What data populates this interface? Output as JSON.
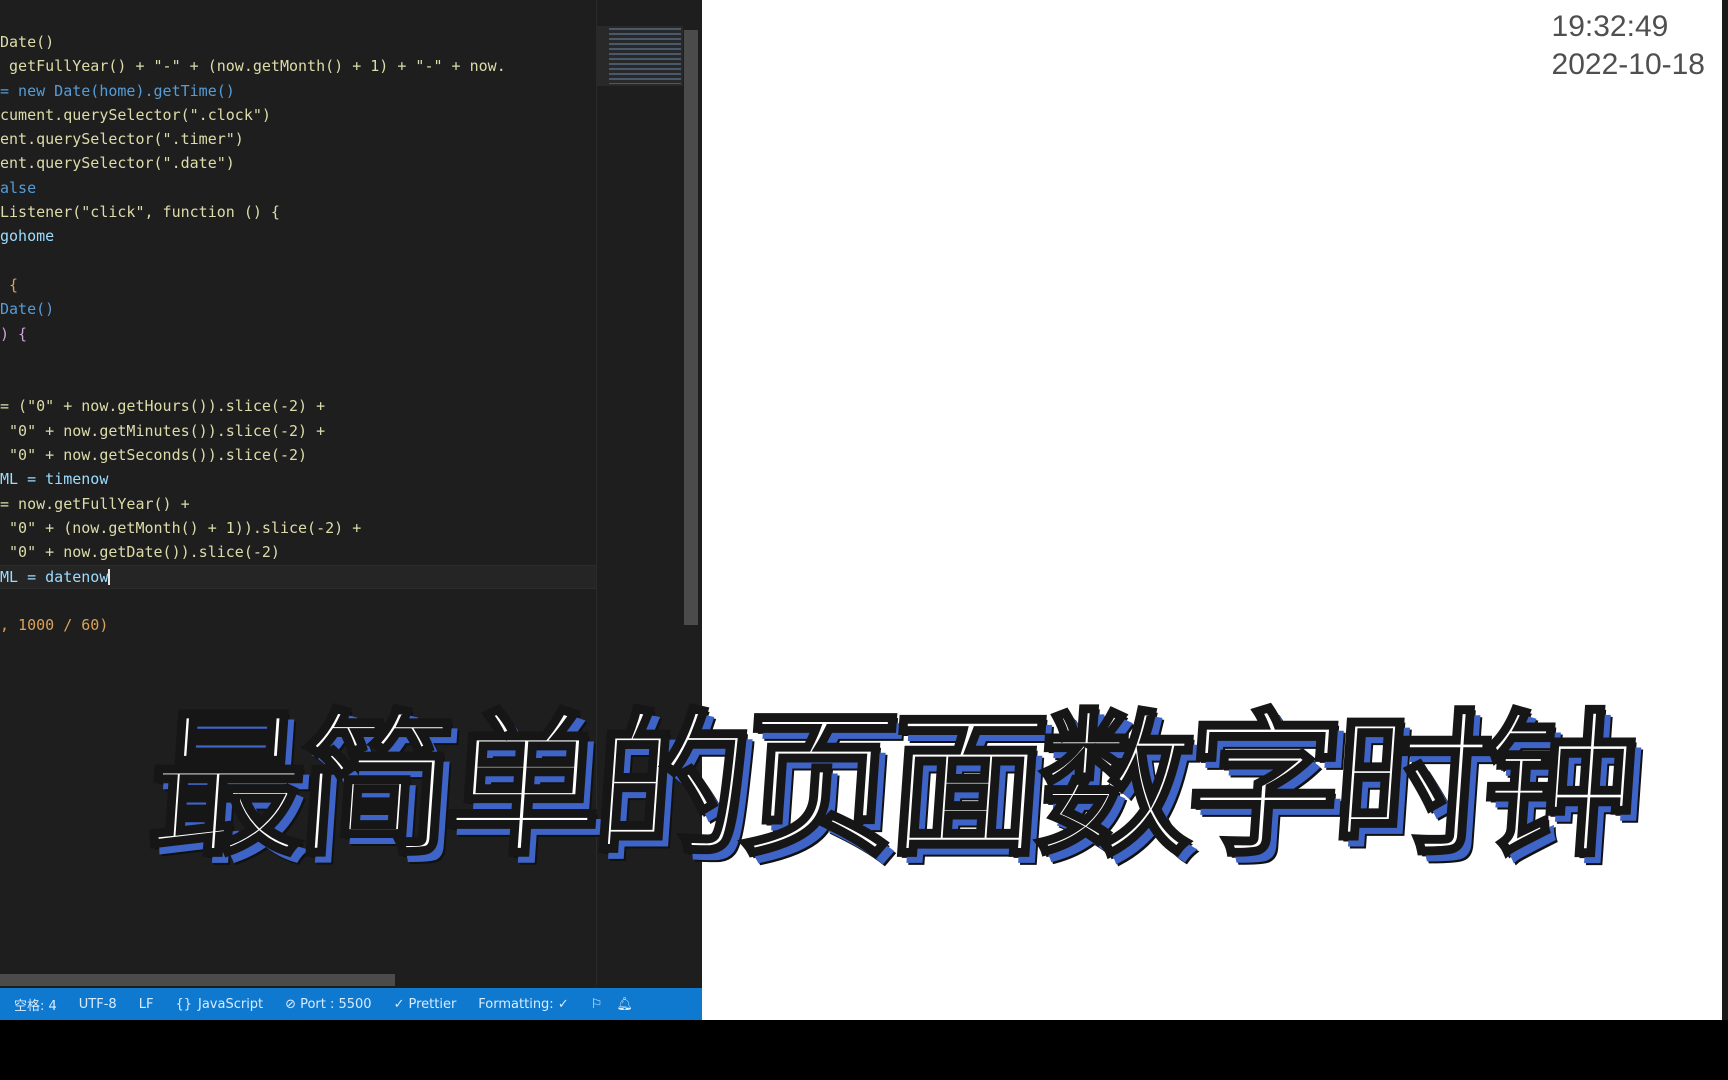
{
  "editor": {
    "code_lines": [
      "Date()",
      " getFullYear() + \"-\" + (now.getMonth() + 1) + \"-\" + now.",
      "= new Date(home).getTime()",
      "cument.querySelector(\".clock\")",
      "ent.querySelector(\".timer\")",
      "ent.querySelector(\".date\")",
      "alse",
      "Listener(\"click\", function () {",
      "gohome",
      "",
      " {",
      "Date()",
      ") {",
      "",
      "",
      "= (\"0\" + now.getHours()).slice(-2) +",
      " \"0\" + now.getMinutes()).slice(-2) +",
      " \"0\" + now.getSeconds()).slice(-2)",
      "ML = timenow",
      "= now.getFullYear() +",
      " \"0\" + (now.getMonth() + 1)).slice(-2) +",
      " \"0\" + now.getDate()).slice(-2)",
      "ML = datenow",
      "",
      ", 1000 / 60)"
    ],
    "status": {
      "spaces": "空格: 4",
      "encoding": "UTF-8",
      "eol": "LF",
      "language": "JavaScript",
      "port": "Port : 5500",
      "prettier": "Prettier",
      "formatting": "Formatting: ✓",
      "feedback_icon": "feedback-icon",
      "bell_icon": "notification-bell-icon"
    },
    "colors": {
      "background": "#1e1e1e",
      "statusbar": "#0f79d0"
    }
  },
  "browser": {
    "clock_time": "19:32:49",
    "clock_date": "2022-10-18"
  },
  "caption": {
    "text": "最简单的页面数字时钟",
    "fill_color": "#ffffff",
    "shadow_color": "#3f64c8"
  }
}
